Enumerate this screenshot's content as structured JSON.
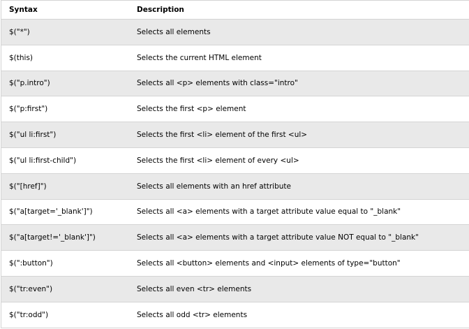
{
  "table": {
    "headers": {
      "syntax": "Syntax",
      "description": "Description"
    },
    "rows": [
      {
        "syntax": "$(\"*\")",
        "description": "Selects all elements"
      },
      {
        "syntax": "$(this)",
        "description": "Selects the current HTML element"
      },
      {
        "syntax": "$(\"p.intro\")",
        "description": "Selects all <p> elements with class=\"intro\""
      },
      {
        "syntax": "$(\"p:first\")",
        "description": "Selects the first <p> element"
      },
      {
        "syntax": "$(\"ul li:first\")",
        "description": "Selects the first <li> element of the first <ul>"
      },
      {
        "syntax": "$(\"ul li:first-child\")",
        "description": "Selects the first <li> element of every <ul>"
      },
      {
        "syntax": "$(\"[href]\")",
        "description": "Selects all elements with an href attribute"
      },
      {
        "syntax": "$(\"a[target='_blank']\")",
        "description": "Selects all <a> elements with a target attribute value equal to \"_blank\""
      },
      {
        "syntax": "$(\"a[target!='_blank']\")",
        "description": "Selects all <a> elements with a target attribute value NOT equal to \"_blank\""
      },
      {
        "syntax": "$(\":button\")",
        "description": "Selects all <button> elements and <input> elements of type=\"button\""
      },
      {
        "syntax": "$(\"tr:even\")",
        "description": "Selects all even <tr> elements"
      },
      {
        "syntax": "$(\"tr:odd\")",
        "description": "Selects all odd <tr> elements"
      }
    ]
  }
}
